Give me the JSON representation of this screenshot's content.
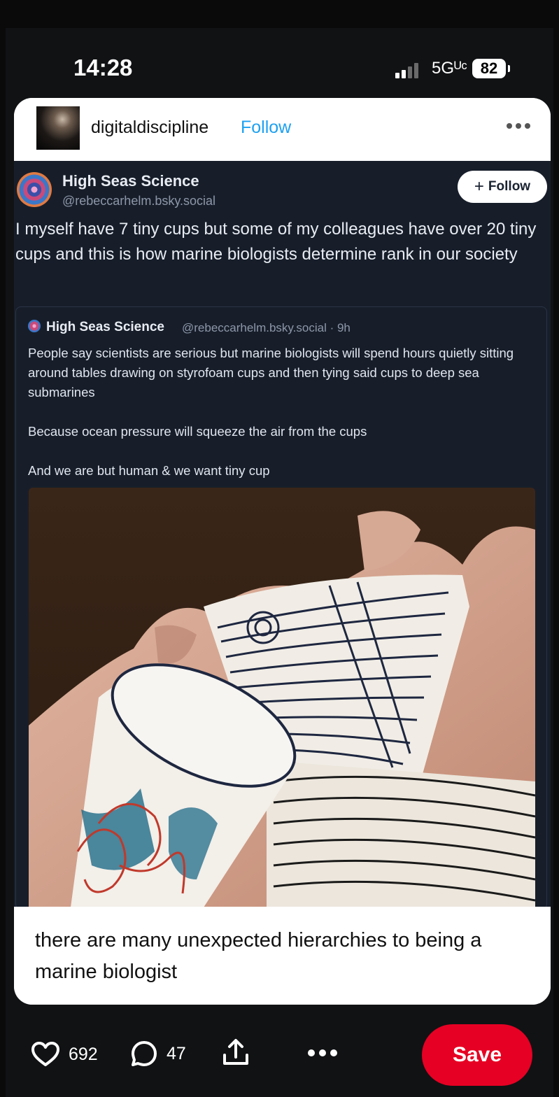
{
  "status_bar": {
    "time": "14:28",
    "network": "5Gᵁᶜ",
    "battery": "82"
  },
  "post_header": {
    "author": "digitaldiscipline",
    "follow_label": "Follow",
    "more_icon": "more-horizontal-icon"
  },
  "embed": {
    "name": "High Seas Science",
    "handle": "@rebeccarhelm.bsky.social",
    "follow_label": "Follow",
    "text": "I myself have 7 tiny cups but some of my colleagues have over 20 tiny cups and this is how marine biologists determine rank in our society",
    "quote": {
      "name": "High Seas Science",
      "meta": "@rebeccarhelm.bsky.social · 9h",
      "paragraphs": [
        "People say scientists are serious but marine biologists will spend hours quietly sitting around tables drawing on styrofoam cups and then tying said cups to deep sea submarines",
        "Because ocean pressure will squeeze the air from the cups",
        "And we are but human & we want tiny cup"
      ]
    }
  },
  "caption": "there are many unexpected hierarchies to being a marine biologist",
  "actions": {
    "likes": "692",
    "comments": "47",
    "save_label": "Save",
    "icons": [
      "heart-icon",
      "comment-icon",
      "share-icon",
      "more-horizontal-icon"
    ]
  },
  "colors": {
    "save_red": "#e60023",
    "follow_blue": "#1da1f2",
    "embed_bg": "#171e2a"
  }
}
